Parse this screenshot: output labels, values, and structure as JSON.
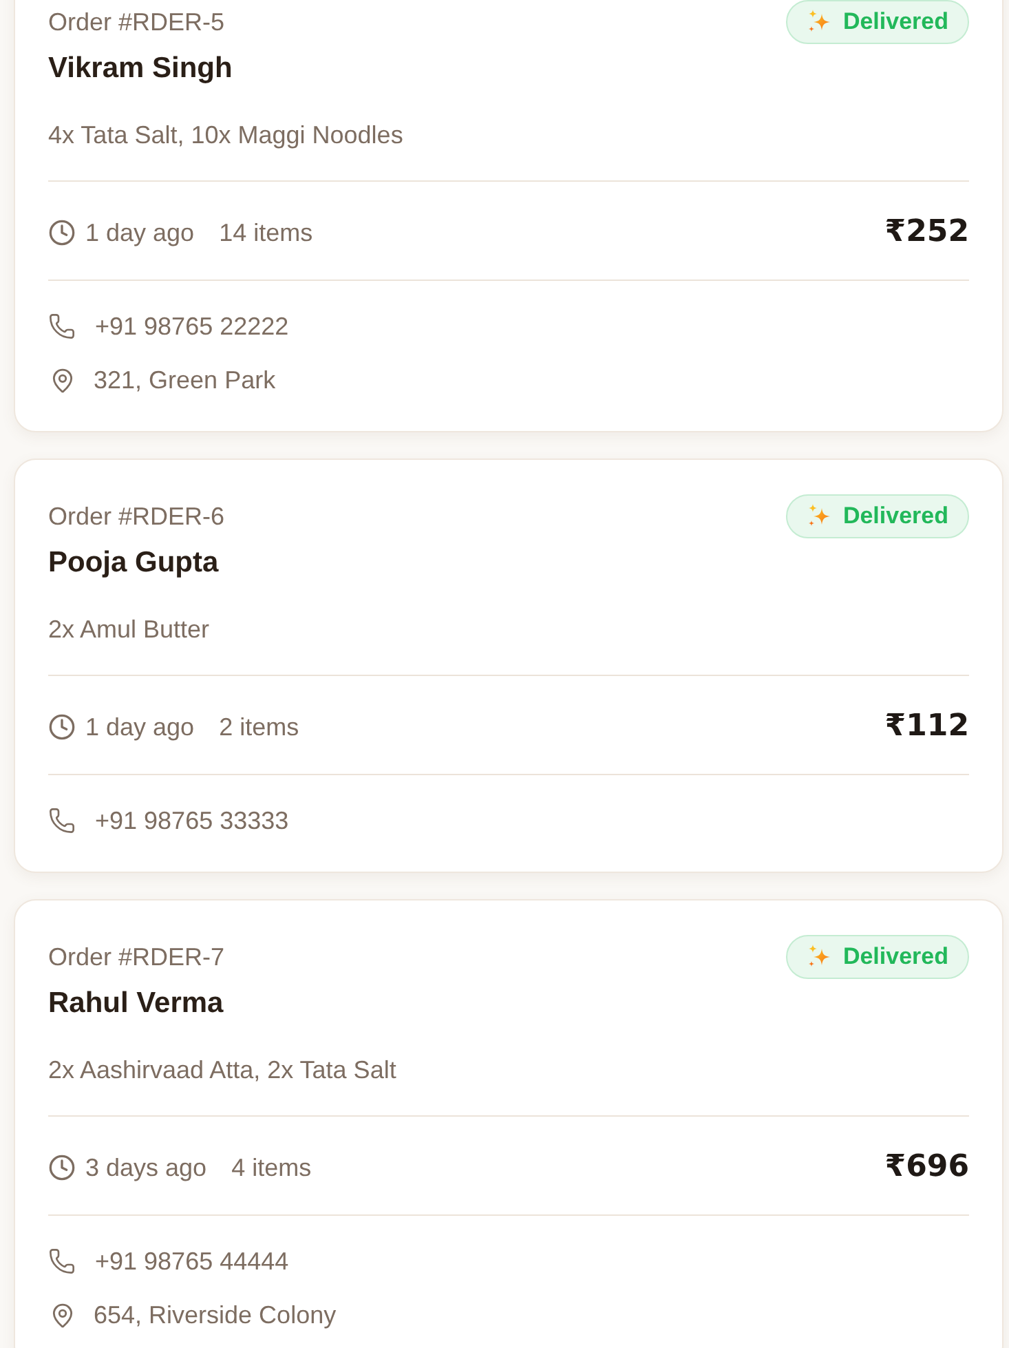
{
  "orders": [
    {
      "order_id": "Order #RDER-5",
      "customer": "Vikram Singh",
      "status": {
        "kind": "delivered",
        "label": "Delivered"
      },
      "items_summary": "4x Tata Salt, 10x Maggi Noodles",
      "time": "1 day ago",
      "item_count": "14 items",
      "total": "₹252",
      "phone": "+91 98765 22222",
      "address": "321, Green Park"
    },
    {
      "order_id": "Order #RDER-6",
      "customer": "Pooja Gupta",
      "status": {
        "kind": "delivered",
        "label": "Delivered"
      },
      "items_summary": "2x Amul Butter",
      "time": "1 day ago",
      "item_count": "2 items",
      "total": "₹112",
      "phone": "+91 98765 33333"
    },
    {
      "order_id": "Order #RDER-7",
      "customer": "Rahul Verma",
      "status": {
        "kind": "delivered",
        "label": "Delivered"
      },
      "items_summary": "2x Aashirvaad Atta, 2x Tata Salt",
      "time": "3 days ago",
      "item_count": "4 items",
      "total": "₹696",
      "phone": "+91 98765 44444",
      "address": "654, Riverside Colony"
    }
  ]
}
